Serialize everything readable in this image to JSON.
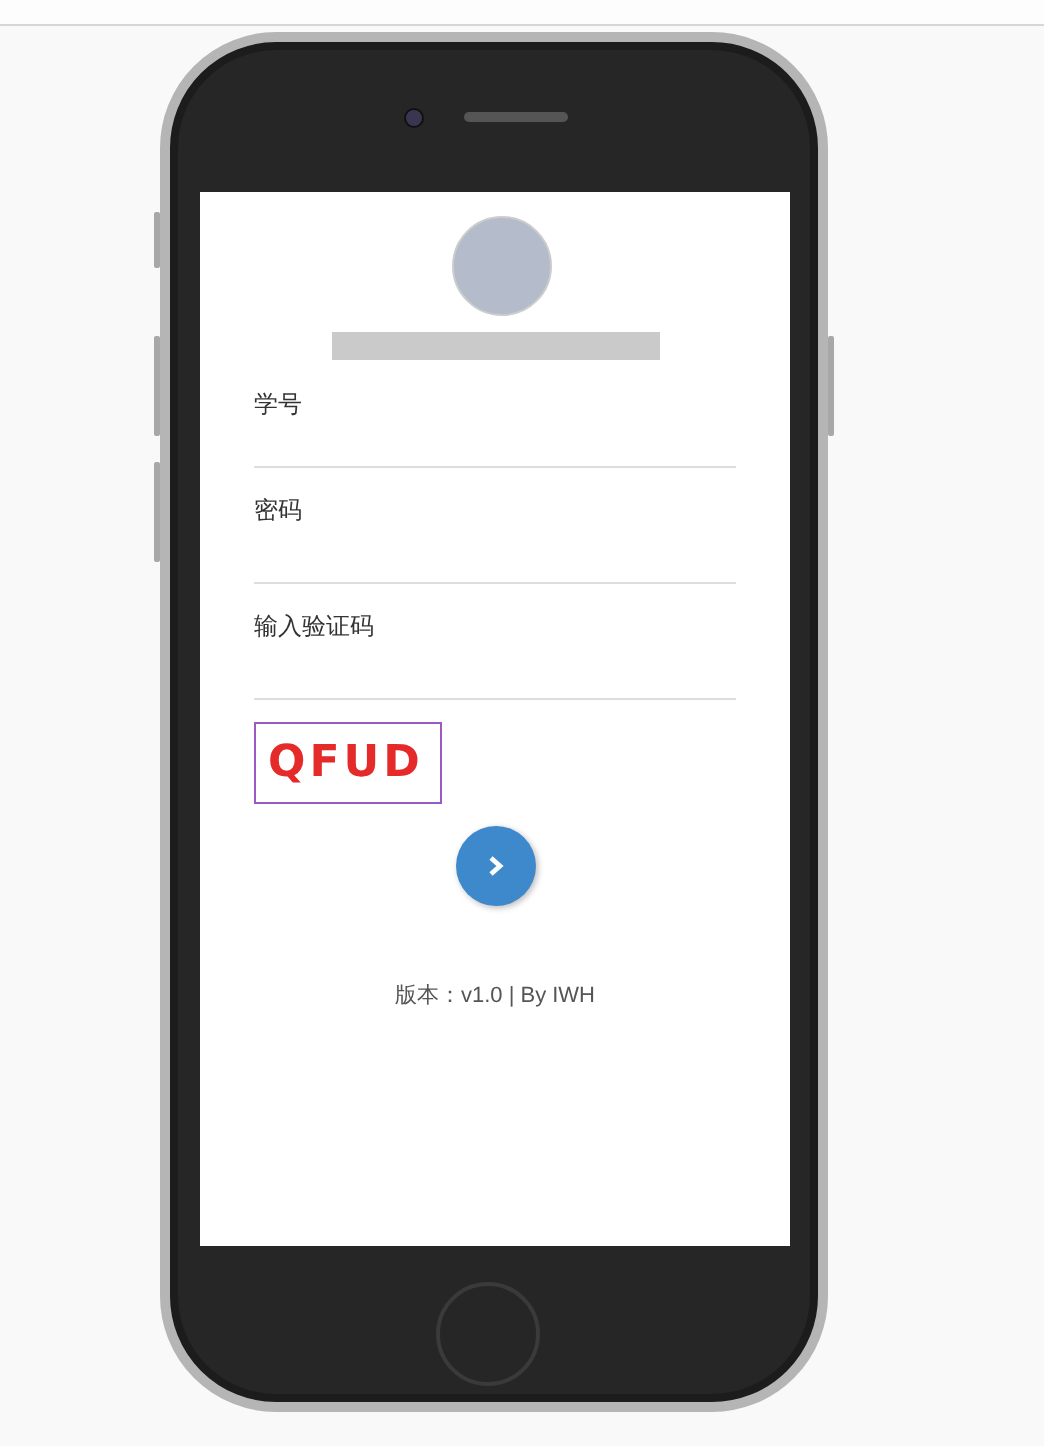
{
  "form": {
    "fields": [
      {
        "label": "学号"
      },
      {
        "label": "密码"
      },
      {
        "label": "输入验证码"
      }
    ],
    "captcha": {
      "text": "QFUD"
    }
  },
  "footer": "版本：v1.0 | By IWH"
}
